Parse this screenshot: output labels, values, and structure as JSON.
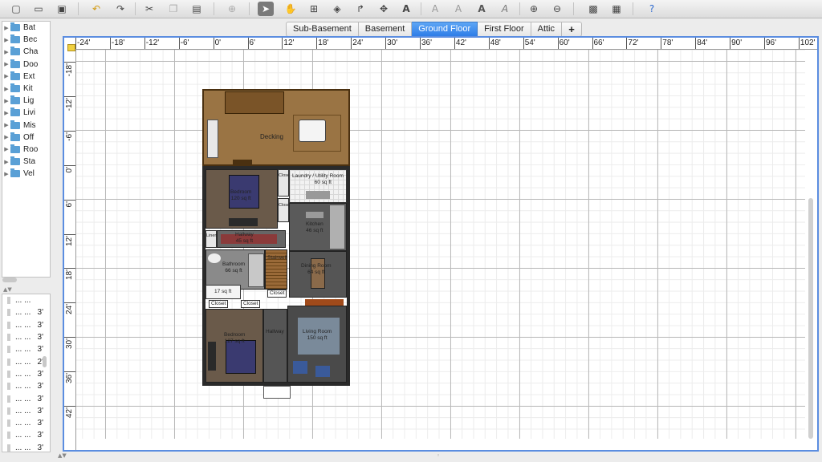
{
  "app": {
    "toolbar_icons": [
      "new-file-icon",
      "open-icon",
      "save-icon",
      "undo-icon",
      "redo-icon",
      "cut-icon",
      "copy-icon",
      "paste-icon",
      "add-furniture-icon",
      "select-icon",
      "pan-icon",
      "create-walls-icon",
      "create-rooms-icon",
      "create-polylines-icon",
      "create-dimensions-icon",
      "add-text-icon",
      "text-style-1-icon",
      "text-style-2-icon",
      "text-style-3-icon",
      "text-style-4-icon",
      "zoom-in-icon",
      "zoom-out-icon",
      "camera-icon",
      "video-icon",
      "help-icon"
    ]
  },
  "catalog": {
    "items": [
      "Bat",
      "Bec",
      "Cha",
      "Doo",
      "Ext",
      "Kit",
      "Lig",
      "Livi",
      "Mis",
      "Off",
      "Roo",
      "Sta",
      "Vel"
    ]
  },
  "furniture_list": {
    "rows": [
      {
        "name": "...",
        "col2": "...",
        "value": ""
      },
      {
        "name": "...",
        "col2": "...",
        "value": "3'"
      },
      {
        "name": "...",
        "col2": "...",
        "value": "3'"
      },
      {
        "name": "...",
        "col2": "...",
        "value": "3'"
      },
      {
        "name": "...",
        "col2": "...",
        "value": "3'"
      },
      {
        "name": "...",
        "col2": "...",
        "value": "2'"
      },
      {
        "name": "...",
        "col2": "...",
        "value": "3'"
      },
      {
        "name": "...",
        "col2": "...",
        "value": "3'"
      },
      {
        "name": "...",
        "col2": "...",
        "value": "3'"
      },
      {
        "name": "...",
        "col2": "...",
        "value": "3'"
      },
      {
        "name": "...",
        "col2": "...",
        "value": "3'"
      },
      {
        "name": "...",
        "col2": "...",
        "value": "3'"
      },
      {
        "name": "...",
        "col2": "...",
        "value": "3'"
      }
    ]
  },
  "tabs": [
    "Sub-Basement",
    "Basement",
    "Ground Floor",
    "First Floor",
    "Attic"
  ],
  "selected_tab": "Ground Floor",
  "add_tab_label": "+",
  "ruler": {
    "horizontal": [
      "-24'",
      "-18'",
      "-12'",
      "-6'",
      "0'",
      "6'",
      "12'",
      "18'",
      "24'",
      "30'",
      "36'",
      "42'",
      "48'",
      "54'",
      "60'",
      "66'",
      "72'",
      "78'",
      "84'",
      "90'",
      "96'",
      "102'"
    ],
    "vertical": [
      "-18'",
      "-12'",
      "-6'",
      "0'",
      "6'",
      "12'",
      "18'",
      "24'",
      "30'",
      "36'",
      "42'"
    ]
  },
  "rooms": {
    "decking": {
      "name": "Decking"
    },
    "laundry": {
      "name": "Laundry / Utility Room",
      "area": "60 sq ft"
    },
    "bedroom1": {
      "name": "Bedroom",
      "area": "120 sq ft"
    },
    "closet_a": {
      "name": "Closet"
    },
    "closet_b": {
      "name": "Closet"
    },
    "kitchen": {
      "name": "Kitchen",
      "area": "46 sq ft"
    },
    "hallway1": {
      "name": "Hallway",
      "area": "45 sq ft"
    },
    "linen": {
      "name": "Linen"
    },
    "bathroom": {
      "name": "Bathroom",
      "area": "66 sq ft"
    },
    "stairwell": {
      "name": "Stairwell"
    },
    "dining": {
      "name": "Dining Room",
      "area": "64 sq ft"
    },
    "small_room": {
      "area": "17 sq ft"
    },
    "closet_c": {
      "name": "Closet"
    },
    "closet_d": {
      "name": "Closet"
    },
    "closet_e": {
      "name": "Closet"
    },
    "bedroom2": {
      "name": "Bedroom",
      "area": "127 sq ft"
    },
    "hallway2": {
      "name": "Hallway"
    },
    "living": {
      "name": "Living Room",
      "area": "150 sq ft"
    }
  },
  "colors": {
    "selected_tab": "#2e7de8",
    "plan_border": "#5b8de0",
    "decking": "#9a7444",
    "bedroom_floor": "#6a5a4a",
    "hallway_floor": "#505050",
    "kitchen_floor": "#9a9a9a"
  }
}
